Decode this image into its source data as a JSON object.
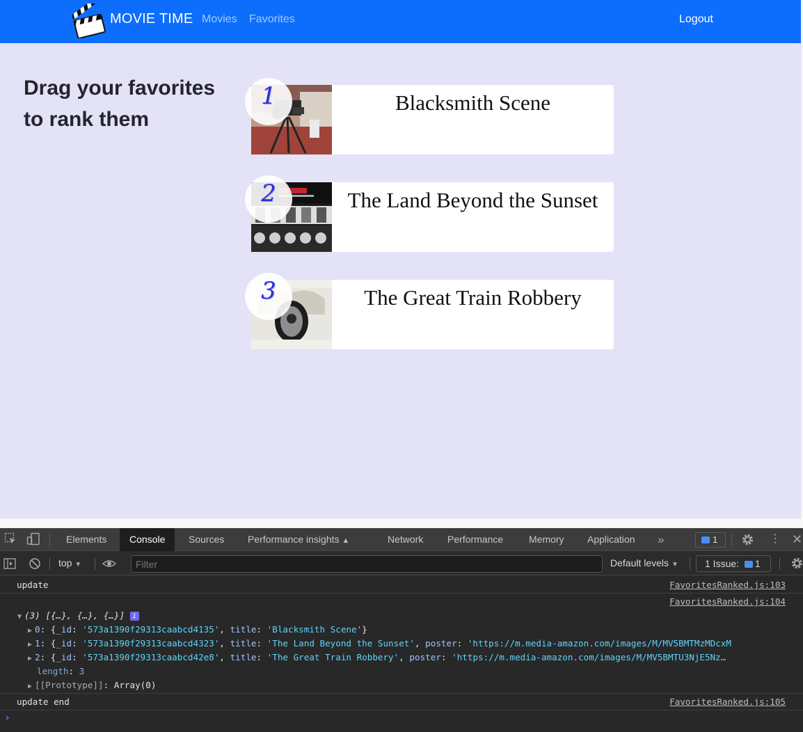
{
  "navbar": {
    "brand": "MOVIE TIME",
    "links": [
      "Movies",
      "Favorites"
    ],
    "logout": "Logout"
  },
  "heading": "Drag your favorites to rank them",
  "favorites": [
    {
      "rank": "1",
      "title": "Blacksmith Scene"
    },
    {
      "rank": "2",
      "title": "The Land Beyond the Sunset"
    },
    {
      "rank": "3",
      "title": "The Great Train Robbery"
    }
  ],
  "devtools": {
    "tabs": [
      "Elements",
      "Console",
      "Sources",
      "Performance insights",
      "Network",
      "Performance",
      "Memory",
      "Application"
    ],
    "active_tab": "Console",
    "more_tabs": "»",
    "message_count": "1",
    "context": "top",
    "filter_placeholder": "Filter",
    "levels": "Default levels",
    "issues_label": "1 Issue:",
    "issues_count": "1",
    "console": {
      "line1_text": "update",
      "line1_src": "FavoritesRanked.js:103",
      "line2_src": "FavoritesRanked.js:104",
      "array_summary": "(3) [{…}, {…}, {…}]",
      "rows": [
        {
          "index": "0",
          "id": "'573a1390f29313caabcd4135'",
          "title": "'Blacksmith Scene'",
          "poster": ""
        },
        {
          "index": "1",
          "id": "'573a1390f29313caabcd4323'",
          "title": "'The Land Beyond the Sunset'",
          "poster": "'https://m.media-amazon.com/images/M/MV5BMTMzMDcxM"
        },
        {
          "index": "2",
          "id": "'573a1390f29313caabcd42e8'",
          "title": "'The Great Train Robbery'",
          "poster": "'https://m.media-amazon.com/images/M/MV5BMTU3NjE5Nz…"
        }
      ],
      "length_label": "length",
      "length_value": "3",
      "prototype_label": "[[Prototype]]",
      "prototype_value": "Array(0)",
      "line3_text": "update end",
      "line3_src": "FavoritesRanked.js:105",
      "prompt": "›"
    }
  },
  "colors": {
    "navbar": "#0d6efd",
    "page_bg": "#e3e2f6",
    "rank_number": "#2b2fd8",
    "devtools_bg": "#282828"
  }
}
